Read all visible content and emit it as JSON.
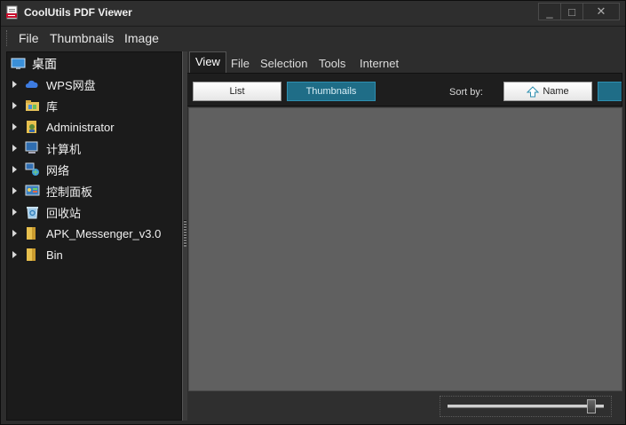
{
  "window": {
    "title": "CoolUtils PDF Viewer",
    "minimize": "_",
    "maximize": "□",
    "close": "✕"
  },
  "menu": {
    "items": [
      "File",
      "Thumbnails",
      "Image"
    ]
  },
  "tree": {
    "root": {
      "label": "桌面",
      "icon": "desktop-icon"
    },
    "items": [
      {
        "label": "WPS网盘",
        "icon": "cloud-icon"
      },
      {
        "label": "库",
        "icon": "library-folder-icon"
      },
      {
        "label": "Administrator",
        "icon": "user-folder-icon"
      },
      {
        "label": "计算机",
        "icon": "computer-icon"
      },
      {
        "label": "网络",
        "icon": "network-icon"
      },
      {
        "label": "控制面板",
        "icon": "control-panel-icon"
      },
      {
        "label": "回收站",
        "icon": "recycle-bin-icon"
      },
      {
        "label": "APK_Messenger_v3.0",
        "icon": "folder-icon"
      },
      {
        "label": "Bin",
        "icon": "folder-icon"
      }
    ]
  },
  "tabs": [
    "View",
    "File",
    "Selection",
    "Tools",
    "Internet"
  ],
  "active_tab": "View",
  "toolbar": {
    "list_label": "List",
    "thumbnails_label": "Thumbnails",
    "sortby_label": "Sort by:",
    "name_label": "Name"
  },
  "zoom_slider": {
    "value": 0.92
  },
  "colors": {
    "accent": "#1f6d87",
    "background": "#2d2d2d",
    "content": "#606060",
    "tree_bg": "#1b1b1b"
  }
}
